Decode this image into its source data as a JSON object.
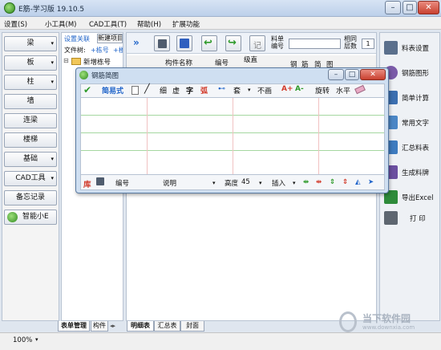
{
  "window": {
    "title": "E筋-学习版 19.10.5"
  },
  "window_controls": {
    "minimize": "–",
    "maximize": "□",
    "close": "✕"
  },
  "menu": [
    "设置(S)",
    "小工具(M)",
    "CAD工具(T)",
    "帮助(H)",
    "扩展功能"
  ],
  "left_buttons": [
    {
      "label": "梁",
      "arrow": "▾"
    },
    {
      "label": "板",
      "arrow": "▾"
    },
    {
      "label": "柱",
      "arrow": "▾"
    },
    {
      "label": "墙",
      "arrow": ""
    },
    {
      "label": "连梁",
      "arrow": ""
    },
    {
      "label": "楼梯",
      "arrow": ""
    },
    {
      "label": "基础",
      "arrow": "▾"
    },
    {
      "label": "CAD工具",
      "arrow": "▾"
    },
    {
      "label": "备忘记录",
      "arrow": ""
    },
    {
      "label": "智能小E",
      "arrow": ""
    }
  ],
  "tree": {
    "settings_link": "设置关联",
    "new_item": "新建项目",
    "file_tree_label": "文件树:",
    "add_building": "+栋号",
    "add_floor": "+楼",
    "root_node": "新增栋号",
    "tree_toggle": "⊟"
  },
  "toolbar": {
    "expand": "»",
    "note_label": "记",
    "sheet_no_label": "料单",
    "sheet_no_label2": "编号",
    "floor_count_label": "相同",
    "floor_count_label2": "层数",
    "floor_count_value": "1"
  },
  "table_headers": [
    "构件名称",
    "编号",
    "级直",
    "钢",
    "筋",
    "简",
    "图"
  ],
  "dialog": {
    "title": "钢筋简图",
    "tools": [
      "简易式",
      "细",
      "虚",
      "字",
      "弧",
      "套",
      "不画",
      "A+",
      "A-",
      "旋转",
      "水平"
    ],
    "bottom": {
      "library": "库",
      "number_label": "编号",
      "desc_label": "说明",
      "height_label": "高度",
      "height_value": "45",
      "insert_label": "插入"
    }
  },
  "right_panel": [
    {
      "label": "料表设置",
      "icon": "gear-icon",
      "color": "#5a6f8c"
    },
    {
      "label": "钢筋图形",
      "icon": "rebar-shape-icon",
      "color": "#7a5aa8"
    },
    {
      "label": "简单计算",
      "icon": "calculator-icon",
      "color": "#3c6fb0"
    },
    {
      "label": "常用文字",
      "icon": "text-icon",
      "color": "#4b86c5"
    },
    {
      "label": "汇总料表",
      "icon": "summary-icon",
      "color": "#3e7bbf"
    },
    {
      "label": "生成料牌",
      "icon": "tag-icon",
      "color": "#6b4fa0"
    },
    {
      "label": "导出Excel",
      "icon": "excel-icon",
      "color": "#2e8b3a"
    },
    {
      "label": "打 印",
      "icon": "printer-icon",
      "color": "#5e6670"
    }
  ],
  "bottom_tabs_left": [
    "表单管理",
    "构件"
  ],
  "bottom_tabs_main": [
    "明细表",
    "汇总表",
    "封面"
  ],
  "status": {
    "zoom": "100%",
    "zoom_arrow": "▾"
  },
  "watermark": {
    "cn": "当下软件园",
    "en": "www.downxia.com"
  },
  "colors": {
    "accent_green": "#2e9a2a",
    "accent_red": "#d23b2b",
    "accent_blue": "#1e63c9"
  }
}
